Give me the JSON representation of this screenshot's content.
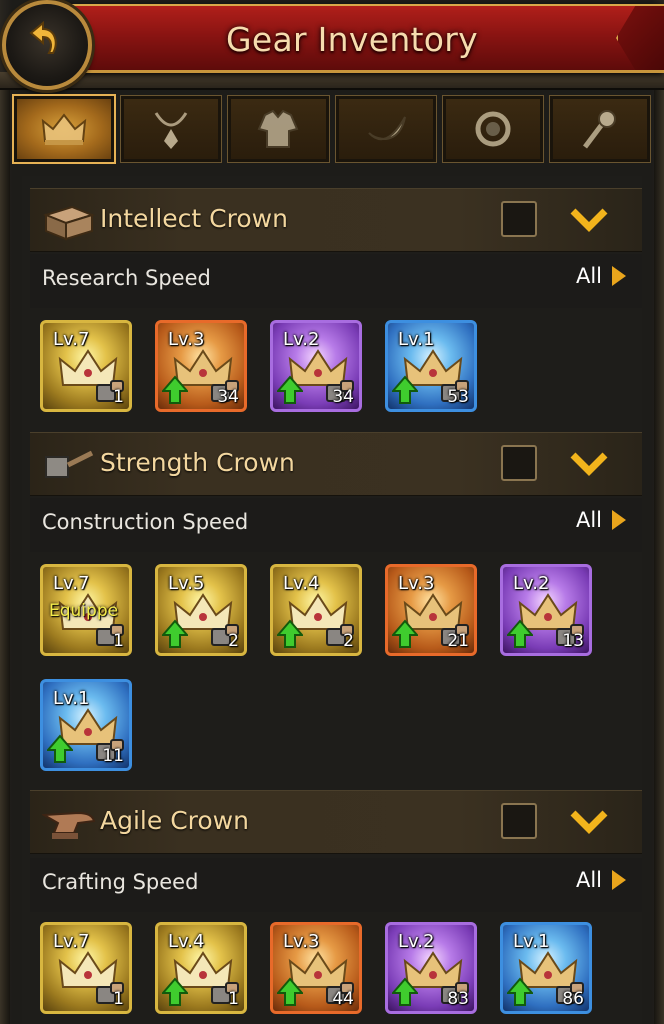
{
  "header": {
    "title": "Gear Inventory",
    "back_icon": "back-arrow-icon"
  },
  "tabs": [
    {
      "icon": "crown-icon",
      "active": true
    },
    {
      "icon": "necklace-icon",
      "active": false
    },
    {
      "icon": "armor-icon",
      "active": false
    },
    {
      "icon": "bracelet-icon",
      "active": false
    },
    {
      "icon": "ring-icon",
      "active": false
    },
    {
      "icon": "scepter-icon",
      "active": false
    }
  ],
  "sections": [
    {
      "title": "Intellect Crown",
      "icon": "book-icon",
      "attribute": "Research Speed",
      "all_label": "All",
      "items": [
        {
          "level": "Lv.7",
          "count": "1",
          "rarity": "gold",
          "equipped": "",
          "upgradable": false
        },
        {
          "level": "Lv.3",
          "count": "34",
          "rarity": "orange",
          "equipped": "",
          "upgradable": true
        },
        {
          "level": "Lv.2",
          "count": "34",
          "rarity": "purple",
          "equipped": "",
          "upgradable": true
        },
        {
          "level": "Lv.1",
          "count": "53",
          "rarity": "blue",
          "equipped": "",
          "upgradable": true
        }
      ]
    },
    {
      "title": "Strength Crown",
      "icon": "hammer-icon",
      "attribute": "Construction Speed",
      "all_label": "All",
      "items": [
        {
          "level": "Lv.7",
          "count": "1",
          "rarity": "gold",
          "equipped": "Equippe",
          "upgradable": false
        },
        {
          "level": "Lv.5",
          "count": "2",
          "rarity": "gold",
          "equipped": "",
          "upgradable": true
        },
        {
          "level": "Lv.4",
          "count": "2",
          "rarity": "gold",
          "equipped": "",
          "upgradable": true
        },
        {
          "level": "Lv.3",
          "count": "21",
          "rarity": "orange",
          "equipped": "",
          "upgradable": true
        },
        {
          "level": "Lv.2",
          "count": "13",
          "rarity": "purple",
          "equipped": "",
          "upgradable": true
        },
        {
          "level": "Lv.1",
          "count": "11",
          "rarity": "blue",
          "equipped": "",
          "upgradable": true
        }
      ]
    },
    {
      "title": "Agile Crown",
      "icon": "anvil-icon",
      "attribute": "Crafting Speed",
      "all_label": "All",
      "items": [
        {
          "level": "Lv.7",
          "count": "1",
          "rarity": "gold",
          "equipped": "",
          "upgradable": false
        },
        {
          "level": "Lv.4",
          "count": "1",
          "rarity": "gold",
          "equipped": "",
          "upgradable": true
        },
        {
          "level": "Lv.3",
          "count": "44",
          "rarity": "orange",
          "equipped": "",
          "upgradable": true
        },
        {
          "level": "Lv.2",
          "count": "83",
          "rarity": "purple",
          "equipped": "",
          "upgradable": true
        },
        {
          "level": "Lv.1",
          "count": "86",
          "rarity": "blue",
          "equipped": "",
          "upgradable": true
        }
      ]
    }
  ]
}
